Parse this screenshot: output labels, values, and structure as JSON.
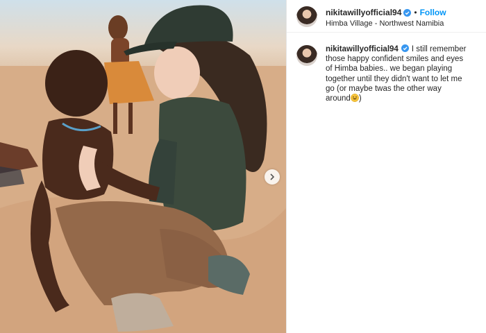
{
  "post": {
    "username": "nikitawillyofficial94",
    "separator": "•",
    "follow_label": "Follow",
    "location": "Himba Village - Northwest Namibia",
    "caption_text": "I still remember those happy confident smiles and eyes of Himba babies.. we began playing together until they didn't want to let me go (or maybe twas the other way around",
    "caption_end": ")"
  },
  "icons": {
    "verified": "verified-badge-icon",
    "next": "chevron-right-icon",
    "emoji": "grinning-face-emoji-icon"
  },
  "colors": {
    "accent": "#0095f6",
    "text": "#262626"
  }
}
